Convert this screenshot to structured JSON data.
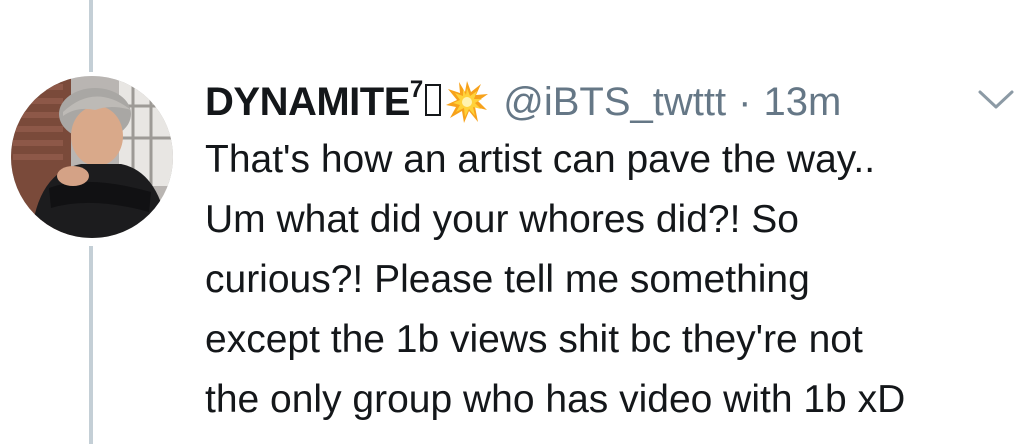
{
  "tweet": {
    "display_name": "DYNAMITE",
    "name_superscript": "7",
    "name_emoji_icon": "collision-icon",
    "handle": "@iBTS_twttt",
    "separator": "·",
    "time_ago": "13m",
    "menu_icon": "chevron-down-icon",
    "text_lines": [
      "That's how an artist can pave the way..",
      "Um what did your whores did?! So",
      "curious?! Please tell me something",
      "except the 1b views shit bc they're not",
      "the only group who has video with 1b xD"
    ]
  },
  "colors": {
    "text_primary": "#14171a",
    "text_secondary": "#657786",
    "thread_line": "#c4cfd6",
    "background": "#ffffff"
  }
}
